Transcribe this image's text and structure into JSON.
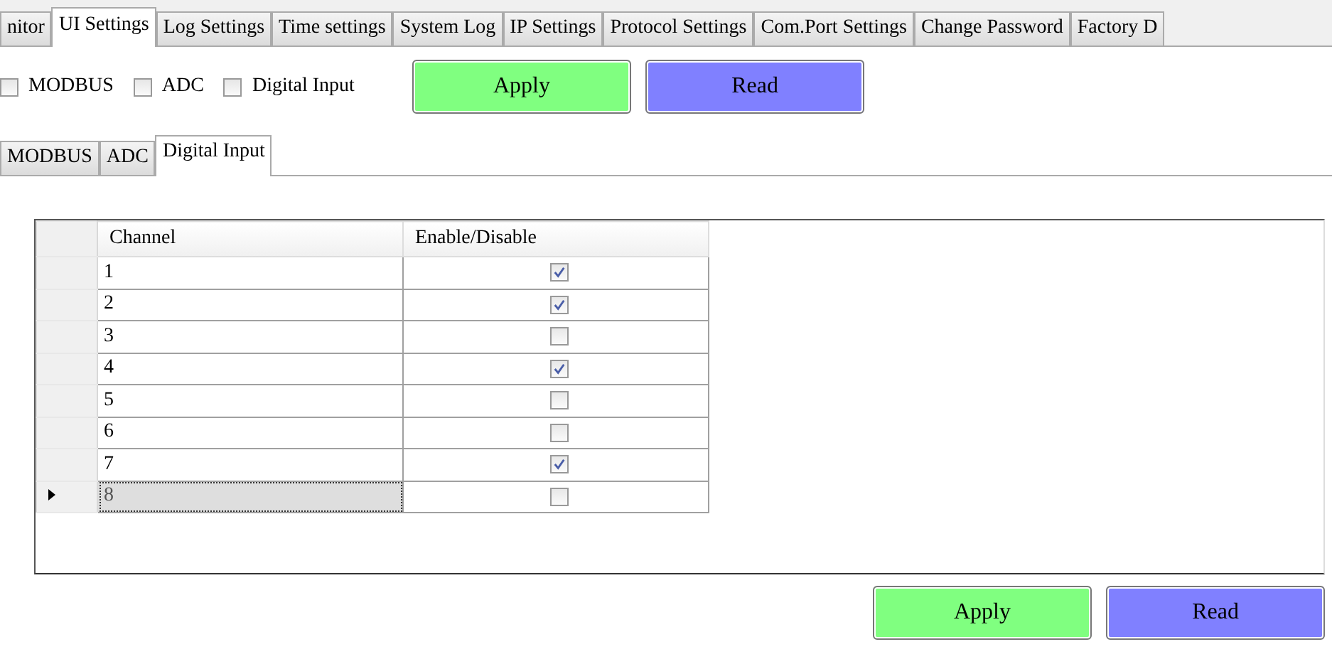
{
  "tabs": [
    {
      "label": "nitor",
      "selected": false
    },
    {
      "label": "UI Settings",
      "selected": true
    },
    {
      "label": "Log Settings",
      "selected": false
    },
    {
      "label": "Time settings",
      "selected": false
    },
    {
      "label": "System Log",
      "selected": false
    },
    {
      "label": "IP Settings",
      "selected": false
    },
    {
      "label": "Protocol Settings",
      "selected": false
    },
    {
      "label": "Com.Port Settings",
      "selected": false
    },
    {
      "label": "Change Password",
      "selected": false
    },
    {
      "label": "Factory D",
      "selected": false
    }
  ],
  "options": [
    {
      "label": "MODBUS",
      "checked": false
    },
    {
      "label": "ADC",
      "checked": false
    },
    {
      "label": "Digital Input",
      "checked": false
    }
  ],
  "top_buttons": [
    {
      "label": "Apply",
      "kind": "apply"
    },
    {
      "label": "Read",
      "kind": "read"
    }
  ],
  "sub_tabs": [
    {
      "label": "MODBUS",
      "selected": false
    },
    {
      "label": "ADC",
      "selected": false
    },
    {
      "label": "Digital Input",
      "selected": true
    }
  ],
  "grid": {
    "columns": [
      "Channel",
      "Enable/Disable"
    ],
    "rows": [
      {
        "channel": "1",
        "enabled": true,
        "selected": false
      },
      {
        "channel": "2",
        "enabled": true,
        "selected": false
      },
      {
        "channel": "3",
        "enabled": false,
        "selected": false
      },
      {
        "channel": "4",
        "enabled": true,
        "selected": false
      },
      {
        "channel": "5",
        "enabled": false,
        "selected": false
      },
      {
        "channel": "6",
        "enabled": false,
        "selected": false
      },
      {
        "channel": "7",
        "enabled": true,
        "selected": false
      },
      {
        "channel": "8",
        "enabled": false,
        "selected": true
      }
    ]
  },
  "bottom_buttons": [
    {
      "label": "Apply",
      "kind": "apply"
    },
    {
      "label": "Read",
      "kind": "read"
    }
  ]
}
